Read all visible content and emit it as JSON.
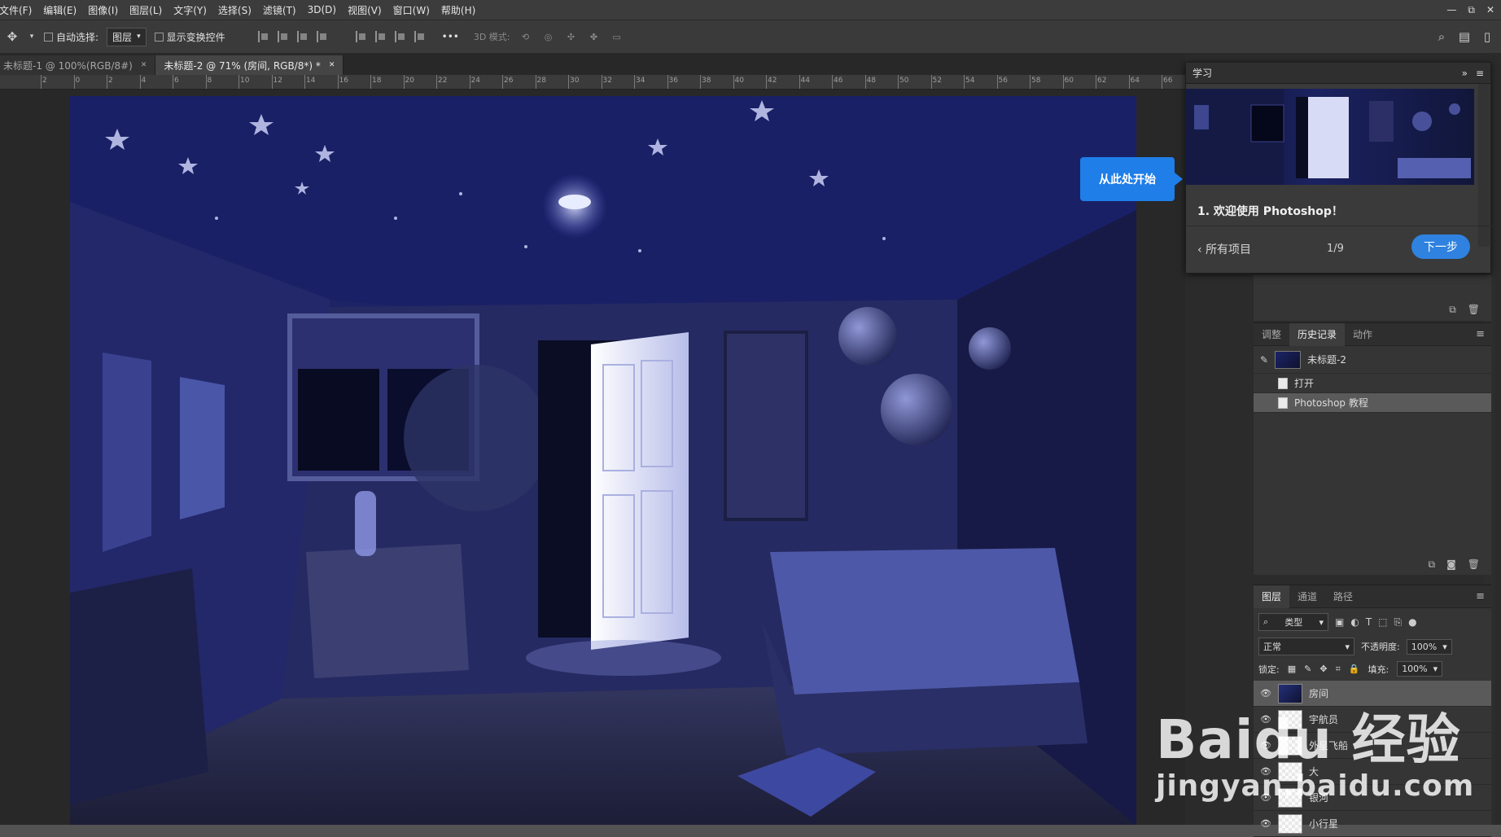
{
  "menu": [
    "文件(F)",
    "编辑(E)",
    "图像(I)",
    "图层(L)",
    "文字(Y)",
    "选择(S)",
    "滤镜(T)",
    "3D(D)",
    "视图(V)",
    "窗口(W)",
    "帮助(H)"
  ],
  "window_controls": [
    "—",
    "⧉",
    "✕"
  ],
  "options": {
    "auto_select_label": "自动选择:",
    "auto_select_value": "图层",
    "show_transform_label": "显示变换控件",
    "more_label": "•••",
    "mode_3d_label": "3D 模式:"
  },
  "tabs": [
    {
      "label": "未标题-1 @ 100%(RGB/8#)",
      "close": "✕"
    },
    {
      "label": "未标题-2 @ 71% (房间, RGB/8*) *",
      "close": "✕"
    }
  ],
  "ruler": [
    "2",
    "0",
    "2",
    "4",
    "6",
    "8",
    "10",
    "12",
    "14",
    "16",
    "18",
    "20",
    "22",
    "24",
    "26",
    "28",
    "30",
    "32",
    "34",
    "36",
    "38",
    "40",
    "42",
    "44",
    "46",
    "48",
    "50",
    "52",
    "54",
    "56",
    "58",
    "60",
    "62",
    "64",
    "66"
  ],
  "learn": {
    "title": "学习",
    "expand": "»",
    "menu": "≡",
    "step_title": "1. 欢迎使用 Photoshop！",
    "back_label": "所有项目",
    "page": "1/9",
    "next_label": "下一步",
    "callout": "从此处开始"
  },
  "history_panel": {
    "tabs": [
      "调整",
      "历史记录",
      "动作"
    ],
    "snapshot_label": "未标题-2",
    "items": [
      "打开",
      "Photoshop 教程"
    ]
  },
  "layers_panel": {
    "tabs": [
      "图层",
      "通道",
      "路径"
    ],
    "filter_label": "类型",
    "blend_mode": "正常",
    "opacity_label": "不透明度:",
    "opacity_value": "100%",
    "lock_label": "锁定:",
    "fill_label": "填充:",
    "fill_value": "100%",
    "layers": [
      "房间",
      "宇航员",
      "外星飞船",
      "大",
      "银河",
      "小行星"
    ]
  },
  "watermark": {
    "line1": "Baidu 经验",
    "line2": "jingyan.baidu.com"
  },
  "colors": {
    "accent": "#1f7ee8",
    "canvas_bg": "#1d2466"
  }
}
